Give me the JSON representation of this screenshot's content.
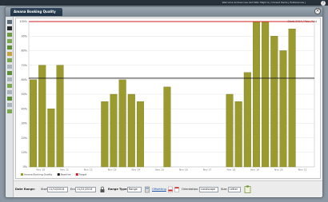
{
  "topbar": {
    "welcome": "Welcome Andrew Lee Abd Wan Majid G | Unread Items | Preferences |",
    "help": "?"
  },
  "window": {
    "title": "Amana Booking Quality",
    "close": "×"
  },
  "crumb": "Start: 2014 / Rev. / List",
  "chart_data": {
    "type": "bar",
    "categories": [
      "1",
      "2",
      "3",
      "4",
      "5",
      "6",
      "7",
      "8",
      "9",
      "10",
      "11",
      "12",
      "13",
      "14",
      "15",
      "16",
      "17",
      "18",
      "19",
      "20",
      "21",
      "22",
      "23",
      "24",
      "25",
      "26",
      "27",
      "28",
      "29",
      "30",
      "31",
      "32"
    ],
    "series": [
      {
        "name": "Amana Booking Quality",
        "values": [
          60,
          70,
          40,
          70,
          0,
          0,
          0,
          0,
          45,
          50,
          60,
          50,
          45,
          0,
          0,
          55,
          0,
          0,
          0,
          0,
          0,
          0,
          50,
          45,
          65,
          100,
          100,
          90,
          80,
          95,
          0,
          0
        ]
      }
    ],
    "reference_lines": [
      {
        "name": "Baseline",
        "value": 61,
        "color": "#1a1a1a"
      },
      {
        "name": "Target",
        "value": 100,
        "color": "#d32020"
      }
    ],
    "x_tick_labels": [
      "Nov 10",
      "Nov 11",
      "Nov 12",
      "Nov 13",
      "Nov 14",
      "Nov 15",
      "Nov 16",
      "Nov 17",
      "Nov 18",
      "Nov 19",
      "Nov 20",
      "Nov 21"
    ],
    "y_tick_labels": [
      "0%",
      "10%",
      "20%",
      "30%",
      "40%",
      "50%",
      "60%",
      "70%",
      "80%",
      "90%",
      "100%"
    ],
    "ylim": [
      0,
      100
    ],
    "bar_color": "#9a9a2e",
    "grid": true,
    "legend_position": "bottom-left"
  },
  "legend": [
    "Amana Booking Quality",
    "Baseline",
    "Target"
  ],
  "footer": {
    "date_range_label": "Date Range:",
    "start_label": "Start",
    "start_value": "11/10/2014",
    "end_label": "End",
    "end_value": "11/21/2014",
    "range_type_label": "Range Type:",
    "range_type_value": "Range",
    "offsetting_label": "Offsetting",
    "orientation_label": "Orientation:",
    "orientation_value": "Landscape",
    "size_label": "Size:",
    "size_value": "Letter"
  }
}
